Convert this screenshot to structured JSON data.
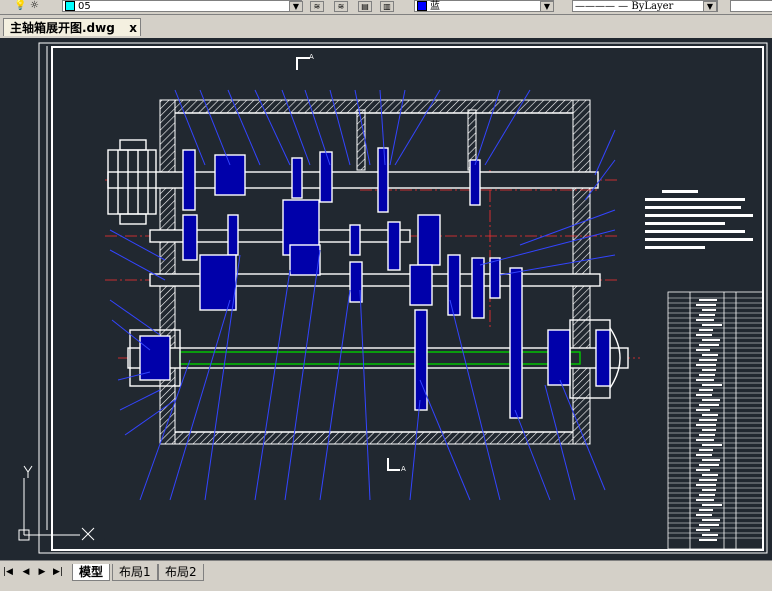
{
  "toolbar": {
    "layer_name": "05",
    "color_name": "蓝",
    "linetype": "ByLayer"
  },
  "document_tab": {
    "title": "主轴箱展开图.dwg",
    "close_glyph": "x"
  },
  "drawing": {
    "ucs_x_label": "X",
    "ucs_y_label": "Y",
    "section_mark_top": "A",
    "section_mark_bottom": "A"
  },
  "layout_tabs": [
    {
      "label": "模型",
      "active": true
    },
    {
      "label": "布局1",
      "active": false
    },
    {
      "label": "布局2",
      "active": false
    }
  ],
  "colors": {
    "canvas_bg": "#212830",
    "gear_fill": "#0000aa",
    "line_white": "#ffffff",
    "leader_blue": "#3344ff",
    "center_red": "#ff3030",
    "shaft_green": "#00cc00"
  }
}
